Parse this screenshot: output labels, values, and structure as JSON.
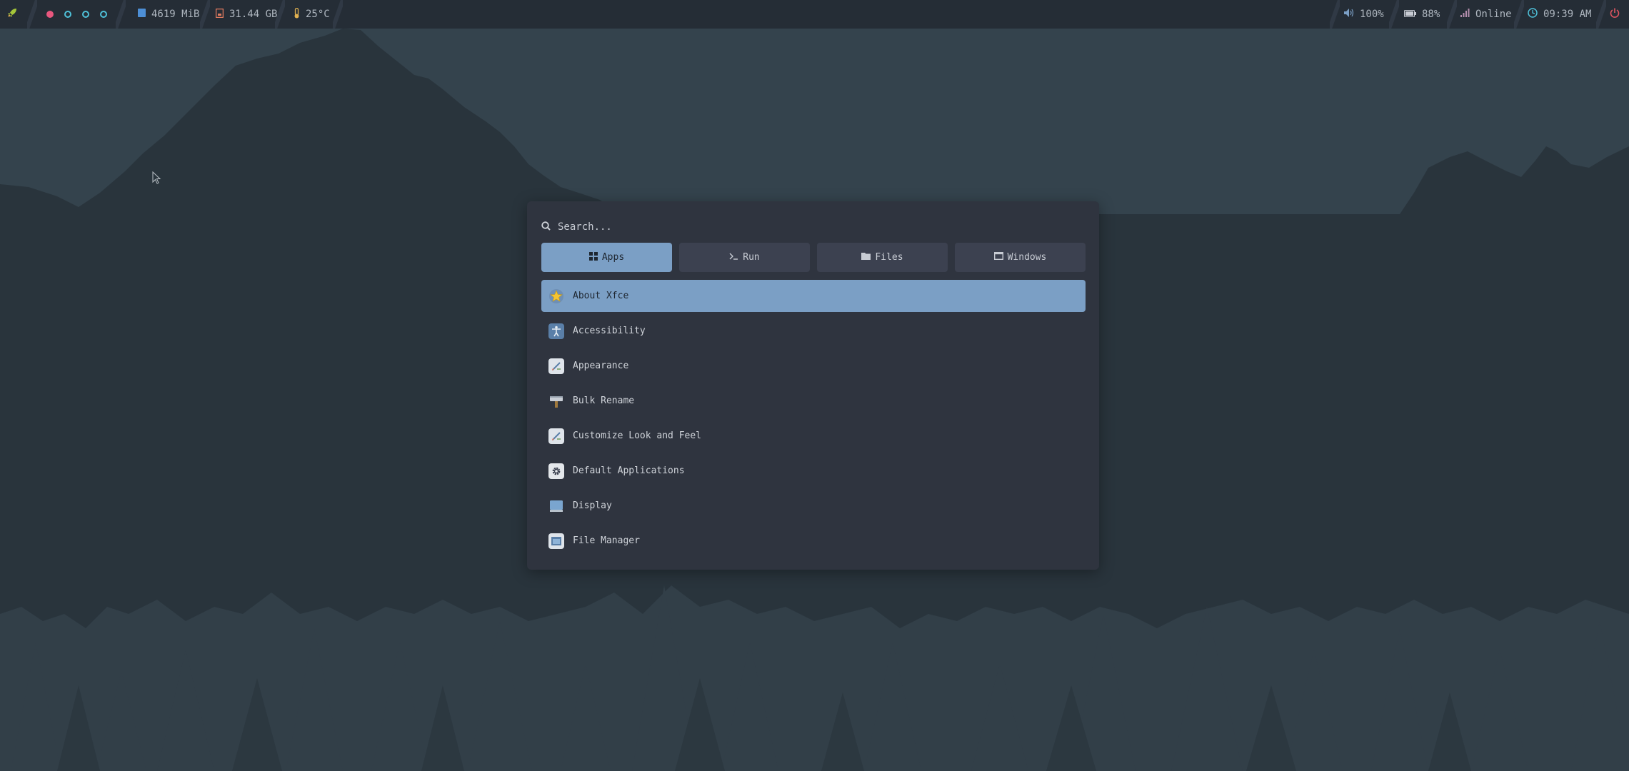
{
  "topbar": {
    "launcher_icon": "rocket-icon",
    "workspaces": [
      {
        "state": "active",
        "color": "#e8577e"
      },
      {
        "state": "inactive",
        "color": "#4fc1d9"
      },
      {
        "state": "inactive",
        "color": "#4fc1d9"
      },
      {
        "state": "inactive",
        "color": "#4fc1d9"
      }
    ],
    "memory": "4619 MiB",
    "disk": "31.44 GB",
    "temperature": "25°C",
    "volume": "100%",
    "battery": "88%",
    "network": "Online",
    "clock": "09:39 AM",
    "colors": {
      "memory": "#4d8fd6",
      "disk": "#e07a5f",
      "temperature": "#e0b050",
      "volume": "#7b9fc5",
      "battery": "#c8ccd4",
      "network": "#b48ead",
      "clock": "#4fc1d9",
      "power": "#e05561"
    }
  },
  "launcher": {
    "search_placeholder": "Search...",
    "tabs": [
      {
        "label": "Apps",
        "icon": "grid-icon",
        "active": true
      },
      {
        "label": "Run",
        "icon": "terminal-icon",
        "active": false
      },
      {
        "label": "Files",
        "icon": "folder-icon",
        "active": false
      },
      {
        "label": "Windows",
        "icon": "window-icon",
        "active": false
      }
    ],
    "apps": [
      {
        "label": "About Xfce",
        "icon": "star-icon",
        "selected": true
      },
      {
        "label": "Accessibility",
        "icon": "accessibility-icon",
        "selected": false
      },
      {
        "label": "Appearance",
        "icon": "appearance-icon",
        "selected": false
      },
      {
        "label": "Bulk Rename",
        "icon": "rename-icon",
        "selected": false
      },
      {
        "label": "Customize Look and Feel",
        "icon": "customize-icon",
        "selected": false
      },
      {
        "label": "Default Applications",
        "icon": "gear-icon",
        "selected": false
      },
      {
        "label": "Display",
        "icon": "display-icon",
        "selected": false
      },
      {
        "label": "File Manager",
        "icon": "file-manager-icon",
        "selected": false
      }
    ],
    "colors": {
      "accent": "#7b9fc5",
      "panel": "#2f343f",
      "tab": "#3c4150"
    }
  }
}
